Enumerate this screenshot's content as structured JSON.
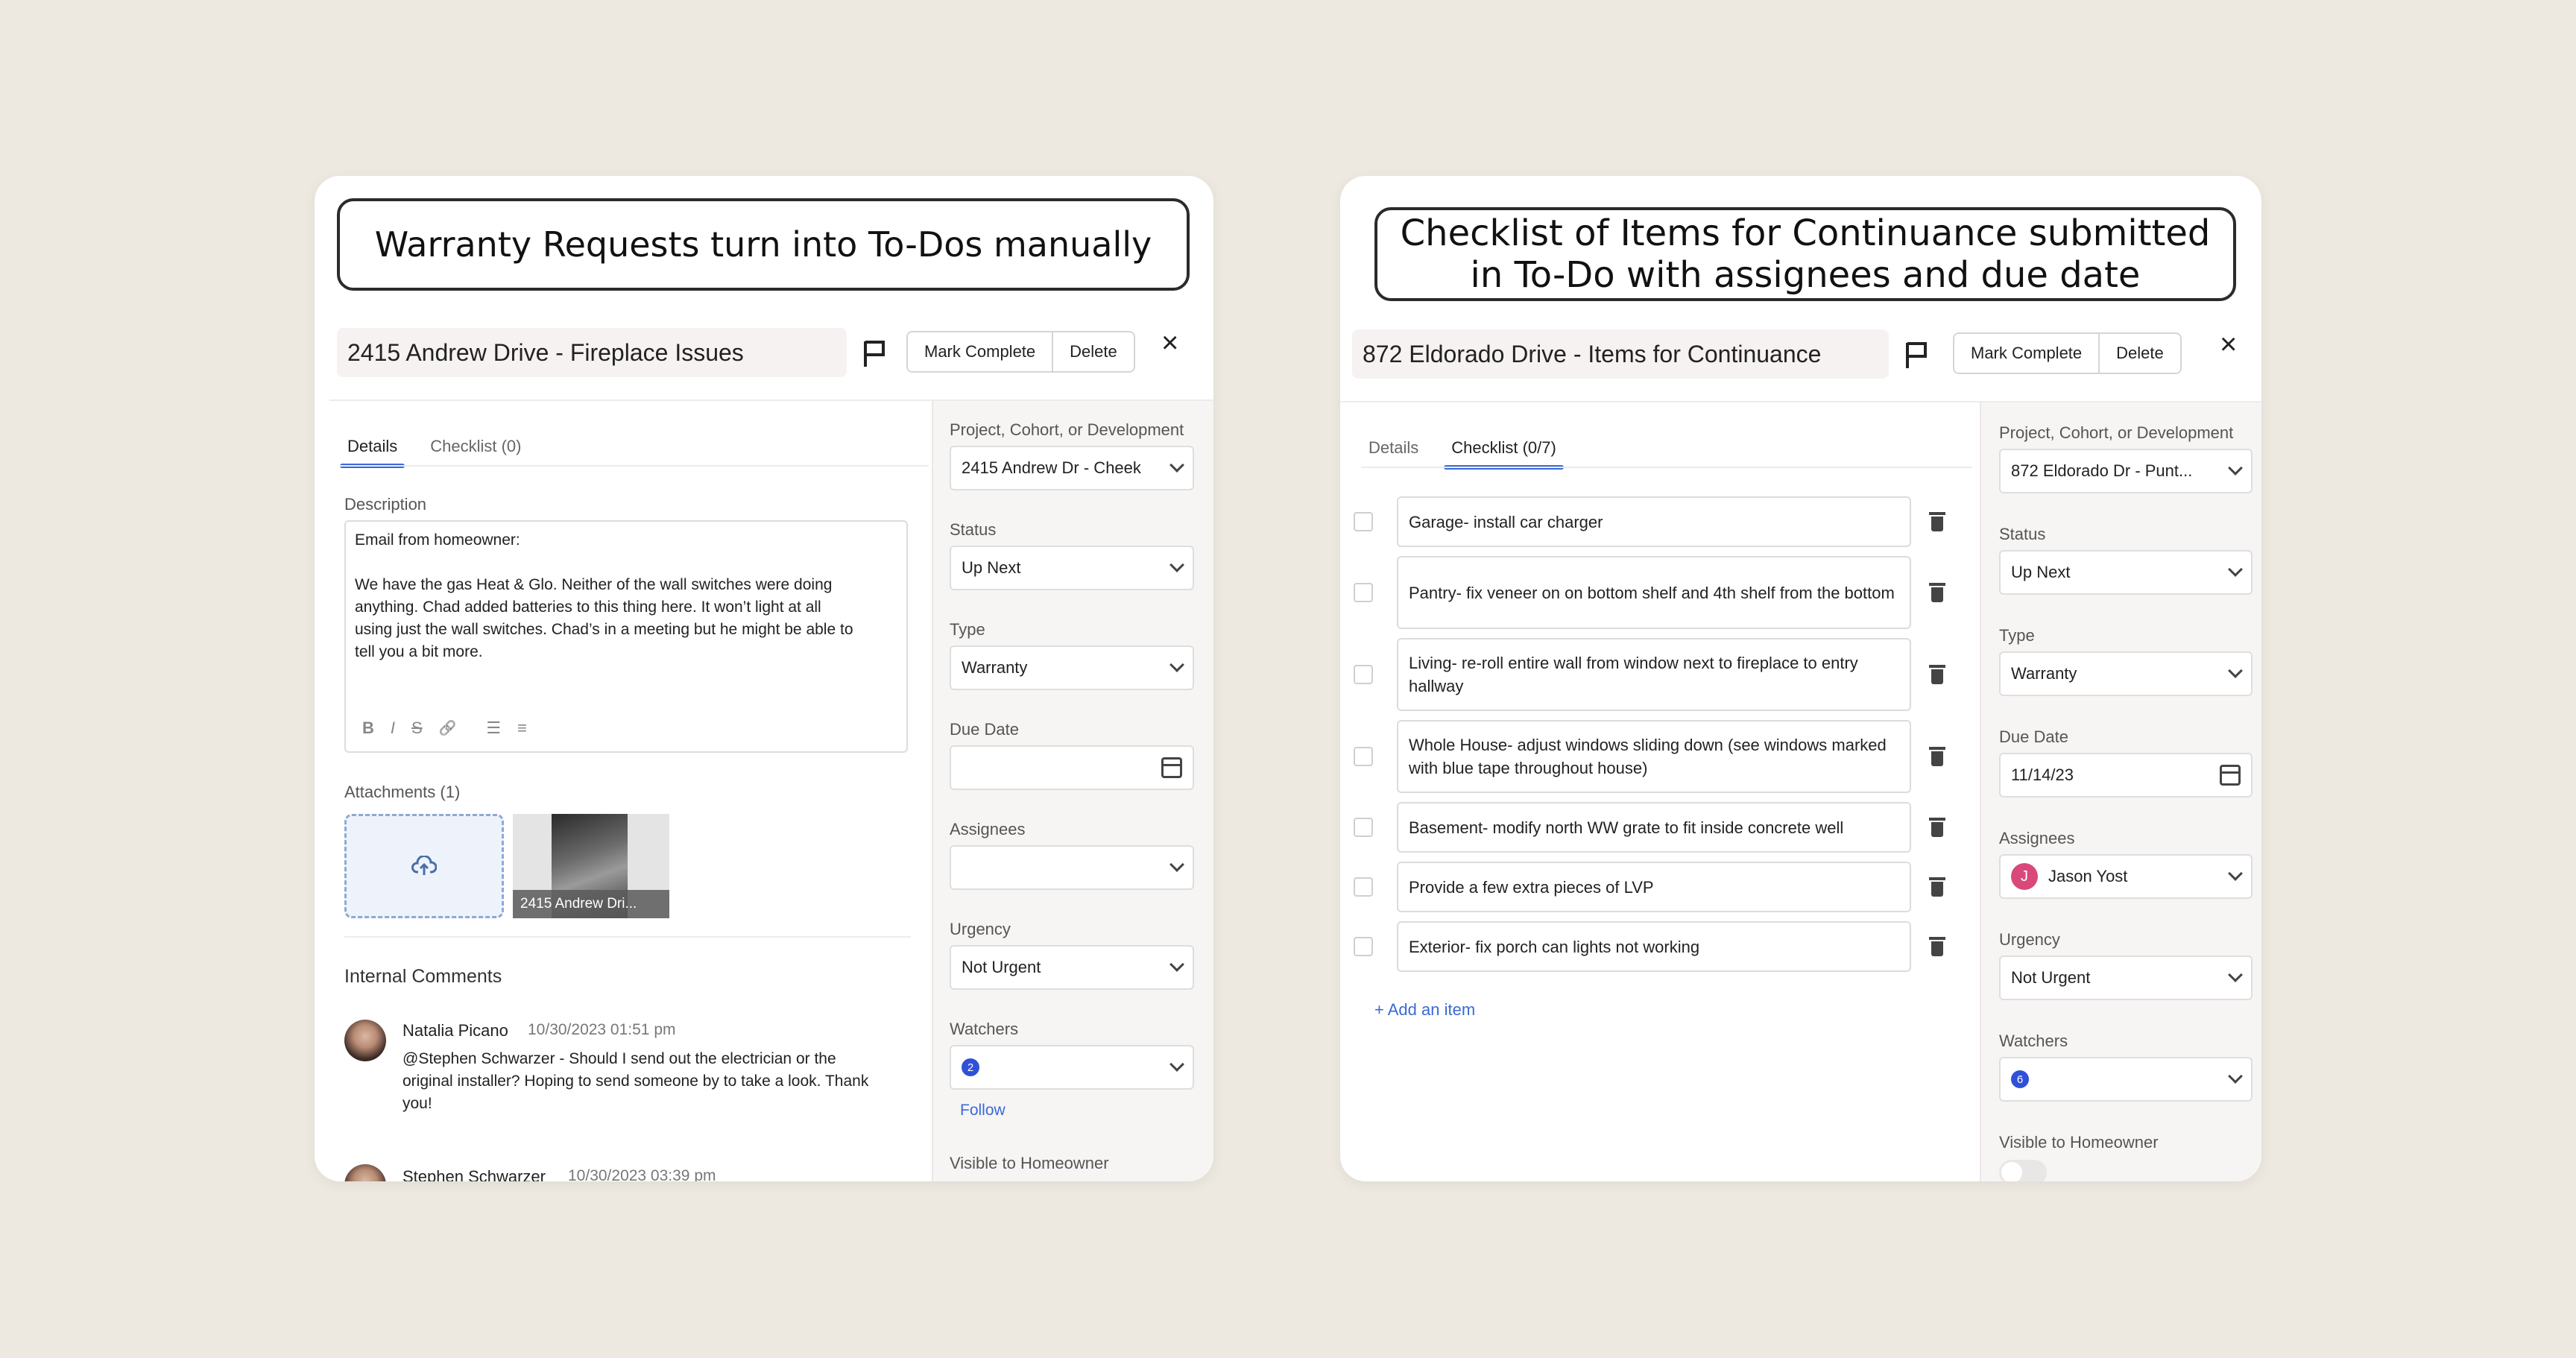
{
  "left": {
    "caption": "Warranty Requests turn into To-Dos manually",
    "title": "2415 Andrew Drive - Fireplace Issues",
    "mark_complete": "Mark Complete",
    "delete": "Delete",
    "close": "×",
    "tabs": [
      "Details",
      "Checklist (0)"
    ],
    "description_label": "Description",
    "description_lines": [
      "Email from homeowner:",
      "",
      "We have the gas Heat & Glo. Neither of the wall switches were doing",
      "anything. Chad added batteries to this thing here. It won’t light at all",
      "using just the wall switches. Chad’s in a meeting but he might be able to",
      "tell you a bit more."
    ],
    "toolbar": [
      "B",
      "I",
      "S",
      "🔗",
      "☰",
      "≡"
    ],
    "attachments_label": "Attachments (1)",
    "attachment_caption": "2415 Andrew Dri...",
    "internal_comments": "Internal Comments",
    "comments": [
      {
        "name": "Natalia Picano",
        "date": "10/30/2023 01:51 pm",
        "lines": [
          "@Stephen Schwarzer - Should I send out the electrician or the",
          "original installer? Hoping to send someone by to take a look. Thank",
          "you!"
        ]
      },
      {
        "name": "Stephen Schwarzer",
        "date": "10/30/2023 03:39 pm"
      }
    ],
    "side": {
      "project_label": "Project, Cohort, or Development",
      "project_value": "2415 Andrew Dr - Cheek",
      "status_label": "Status",
      "status_value": "Up Next",
      "type_label": "Type",
      "type_value": "Warranty",
      "due_label": "Due Date",
      "due_value": "",
      "assignees_label": "Assignees",
      "urgency_label": "Urgency",
      "urgency_value": "Not Urgent",
      "watchers_label": "Watchers",
      "watchers_count": "2",
      "follow": "Follow",
      "visible_label": "Visible to Homeowner"
    }
  },
  "right": {
    "caption_line1": "Checklist of Items for Continuance submitted",
    "caption_line2": "in To-Do with assignees and due date",
    "title": "872 Eldorado Drive - Items for Continuance",
    "mark_complete": "Mark Complete",
    "delete": "Delete",
    "close": "×",
    "tabs": [
      "Details",
      "Checklist (0/7)"
    ],
    "checklist": [
      "Garage- install car charger",
      "Pantry- fix veneer on on bottom shelf and 4th shelf from the bottom",
      "Living- re-roll entire wall from window next to fireplace to entry hallway",
      "Whole House- adjust windows sliding down (see windows marked with blue tape throughout house)",
      "Basement- modify north WW grate to fit inside concrete well",
      "Provide a few extra pieces of LVP",
      "Exterior- fix porch can lights not working"
    ],
    "add_item": "+ Add an item",
    "side": {
      "project_label": "Project, Cohort, or Development",
      "project_value": "872 Eldorado Dr - Punt...",
      "status_label": "Status",
      "status_value": "Up Next",
      "type_label": "Type",
      "type_value": "Warranty",
      "due_label": "Due Date",
      "due_value": "11/14/23",
      "assignees_label": "Assignees",
      "assignee_initial": "J",
      "assignee_name": "Jason Yost",
      "urgency_label": "Urgency",
      "urgency_value": "Not Urgent",
      "watchers_label": "Watchers",
      "watchers_count": "6",
      "visible_label": "Visible to Homeowner"
    }
  }
}
